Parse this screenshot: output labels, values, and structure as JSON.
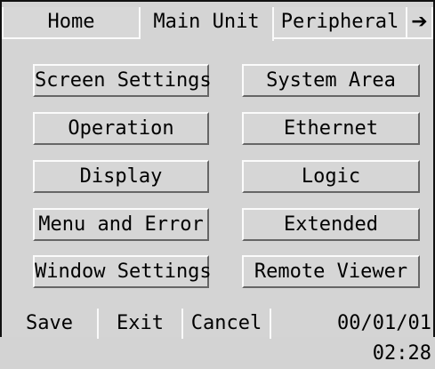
{
  "tabs": {
    "home": "Home",
    "main_unit": "Main Unit",
    "peripheral": "Peripheral",
    "next_icon": "arrow-right-icon"
  },
  "buttons": {
    "screen_settings": "Screen Settings",
    "system_area": "System Area",
    "operation": "Operation",
    "ethernet": "Ethernet",
    "display": "Display",
    "logic": "Logic",
    "menu_and_error": "Menu and Error",
    "extended": "Extended",
    "window_settings": "Window Settings",
    "remote_viewer": "Remote Viewer"
  },
  "footer": {
    "save": "Save",
    "exit": "Exit",
    "cancel": "Cancel",
    "datetime": "00/01/01 02:28"
  }
}
